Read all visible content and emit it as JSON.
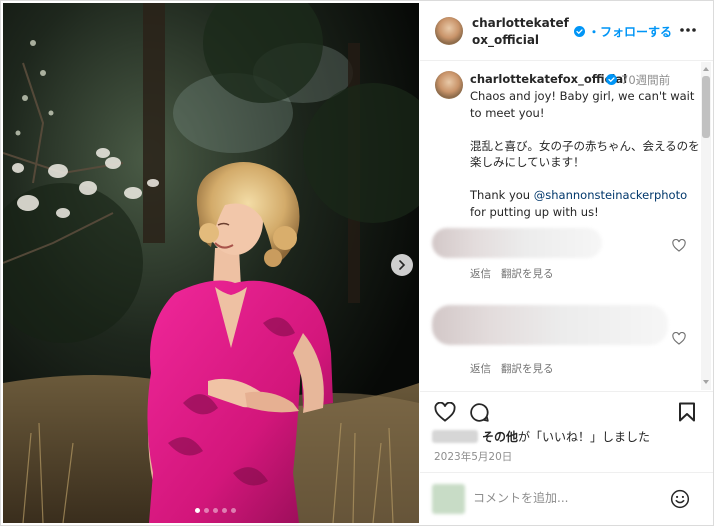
{
  "post": {
    "username": "charlottekatefox_official",
    "follow_label": "フォローする",
    "carousel": {
      "slides": 5,
      "active_index": 0
    }
  },
  "caption": {
    "username": "charlottekatefox_official",
    "time": "70週間前",
    "line_en": "Chaos and joy! Baby girl, we can't wait to meet you!",
    "line_ja": "混乱と喜び。女の子の赤ちゃん、会えるのを楽しみにしています！",
    "thanks_prefix": "Thank you ",
    "mention": "@shannonsteinackerphoto",
    "thanks_suffix": " for putting up with us!"
  },
  "comments": [
    {
      "reply_label": "返信",
      "translate_label": "翻訳を見る"
    },
    {
      "reply_label": "返信",
      "translate_label": "翻訳を見る"
    }
  ],
  "likes": {
    "others": "その他",
    "suffix": "が「いいね！」しました"
  },
  "date": "2023年5月20日",
  "add_comment": {
    "placeholder": "コメントを追加..."
  },
  "icons": {
    "verified": "verified-badge-icon",
    "more": "more-options-icon",
    "like": "heart-icon",
    "comment": "speech-bubble-icon",
    "save": "bookmark-icon",
    "next": "chevron-right-icon",
    "emoji": "smiley-icon"
  },
  "colors": {
    "accent": "#0095f6",
    "dress": "#d3167b",
    "text": "#262626",
    "muted": "#8e8e8e"
  }
}
